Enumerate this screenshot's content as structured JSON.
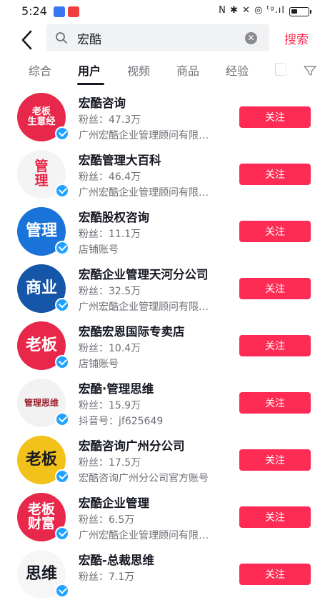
{
  "status": {
    "time": "5:24",
    "icons": "N ✱ ✕ ◎ ᵗᵍ.ıl"
  },
  "search": {
    "query": "宏酷",
    "submit_label": "搜索"
  },
  "tabs": [
    "综合",
    "用户",
    "视频",
    "商品",
    "经验"
  ],
  "users": [
    {
      "name": "宏酷咨询",
      "fans": "粉丝：47.3万",
      "desc": "广州宏酷企业管理顾问有限…",
      "follow": "关注",
      "avatar_text": "老板\n生意经",
      "avatar_bg": "#e8284a",
      "avatar_fg": "#ffffff"
    },
    {
      "name": "宏酷管理大百科",
      "fans": "粉丝：46.4万",
      "desc": "广州宏酷企业管理顾问有限…",
      "follow": "关注",
      "avatar_text": "管\n理",
      "avatar_bg": "#f4f4f4",
      "avatar_fg": "#e8284a"
    },
    {
      "name": "宏酷股权咨询",
      "fans": "粉丝：11.1万",
      "desc": "店铺账号",
      "follow": "关注",
      "avatar_text": "管理",
      "avatar_bg": "#1a73d9",
      "avatar_fg": "#ffffff"
    },
    {
      "name": "宏酷企业管理天河分公司",
      "fans": "粉丝：32.5万",
      "desc": "广州宏酷企业管理顾问有限…",
      "follow": "关注",
      "avatar_text": "商业",
      "avatar_bg": "#1656a8",
      "avatar_fg": "#ffffff"
    },
    {
      "name": "宏酷宏恩国际专卖店",
      "fans": "粉丝：10.4万",
      "desc": "店铺账号",
      "follow": "关注",
      "avatar_text": "老板",
      "avatar_bg": "#e8284a",
      "avatar_fg": "#ffffff"
    },
    {
      "name": "宏酷·管理思维",
      "fans": "粉丝：15.9万",
      "desc": "抖音号：jf625649",
      "follow": "关注",
      "avatar_text": "管理思维",
      "avatar_bg": "#f2f2f2",
      "avatar_fg": "#9b1d2c"
    },
    {
      "name": "宏酷咨询广州分公司",
      "fans": "粉丝：17.5万",
      "desc": "宏酷咨询广州分公司官方账号",
      "follow": "关注",
      "avatar_text": "老板",
      "avatar_bg": "#f2c21b",
      "avatar_fg": "#161823"
    },
    {
      "name": "宏酷企业管理",
      "fans": "粉丝：6.5万",
      "desc": "广州宏酷企业管理顾问有限…",
      "follow": "关注",
      "avatar_text": "老板\n财富",
      "avatar_bg": "#e8284a",
      "avatar_fg": "#ffffff"
    },
    {
      "name": "宏酷-总裁思维",
      "fans": "粉丝：7.1万",
      "desc": "",
      "follow": "关注",
      "avatar_text": "思维",
      "avatar_bg": "#f6f6f6",
      "avatar_fg": "#161823"
    }
  ],
  "colors": {
    "accent": "#fe2c55",
    "verified": "#1fa3ff",
    "text": "#161823",
    "muted": "#6e6f76"
  }
}
